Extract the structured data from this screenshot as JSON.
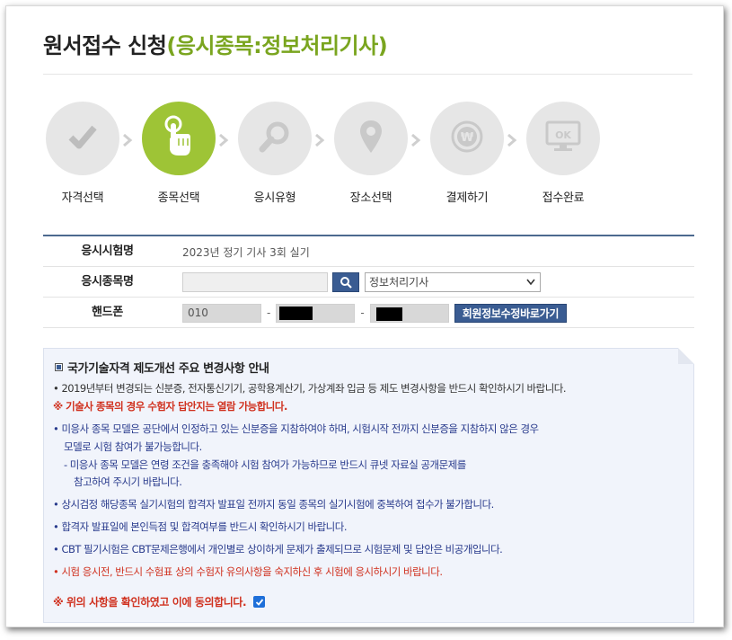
{
  "header": {
    "title_main": "원서접수 신청",
    "title_accent": "(응시종목:정보처리기사)",
    "accent_color": "#7aa51f"
  },
  "steps": [
    {
      "label": "자격선택",
      "icon": "check-icon",
      "active": false
    },
    {
      "label": "종목선택",
      "icon": "pointer-hand-icon",
      "active": true
    },
    {
      "label": "응시유형",
      "icon": "magnifier-icon",
      "active": false
    },
    {
      "label": "장소선택",
      "icon": "map-pin-icon",
      "active": false
    },
    {
      "label": "결제하기",
      "icon": "won-coin-icon",
      "active": false
    },
    {
      "label": "접수완료",
      "icon": "monitor-ok-icon",
      "active": false
    }
  ],
  "form": {
    "exam_name_label": "응시시험명",
    "exam_name_value": "2023년 정기 기사 3회 실기",
    "subject_label": "응시종목명",
    "subject_search_value": "",
    "subject_selected": "정보처리기사",
    "phone_label": "핸드폰",
    "phone_part1": "010",
    "phone_part2": "",
    "phone_part3": "",
    "phone_separator": "-",
    "member_button": "회원정보수정바로가기"
  },
  "notice": {
    "title": "국가기술자격 제도개선 주요 변경사항 안내",
    "lines": [
      "• 2019년부터 변경되는 신분증, 전자통신기기, 공학용계산기, 가상계좌 입금 등 제도 변경사항을 반드시 확인하시기 바랍니다.",
      "※ 기술사 종목의 경우 수험자 답안지는 열람 가능합니다.",
      "• 미응사 종목 모델은 공단에서 인정하고 있는 신분증을 지참하여야 하며, 시험시작 전까지 신분증을 지참하지 않은 경우",
      "모델로 시험 참여가 불가능합니다.",
      "- 미응사 종목 모델은 연령 조건을 충족해야 시험 참여가 가능하므로 반드시 큐넷 자료실 공개문제를",
      "참고하여 주시기 바랍니다.",
      "• 상시검정 해당종목 실기시험의 합격자 발표일 전까지 동일 종목의 실기시험에 중복하여 접수가 불가합니다.",
      "• 합격자 발표일에 본인득점 및 합격여부를 반드시 확인하시기 바랍니다.",
      "• CBT 필기시험은 CBT문제은행에서 개인별로 상이하게 문제가 출제되므로 시험문제 및 답안은 비공개입니다.",
      "• 시험 응시전, 반드시 수험표 상의 수험자 유의사항을 숙지하신 후 시험에 응시하시기 바랍니다."
    ],
    "agree_text": "※ 위의 사항을 확인하였고 이에 동의합니다.",
    "agree_checked": true
  },
  "colors": {
    "active_step": "#9ec436",
    "inactive_step": "#e6e6e6",
    "notice_blue": "#283a8c",
    "notice_red": "#d0311f",
    "button_navy": "#3a5c92"
  }
}
